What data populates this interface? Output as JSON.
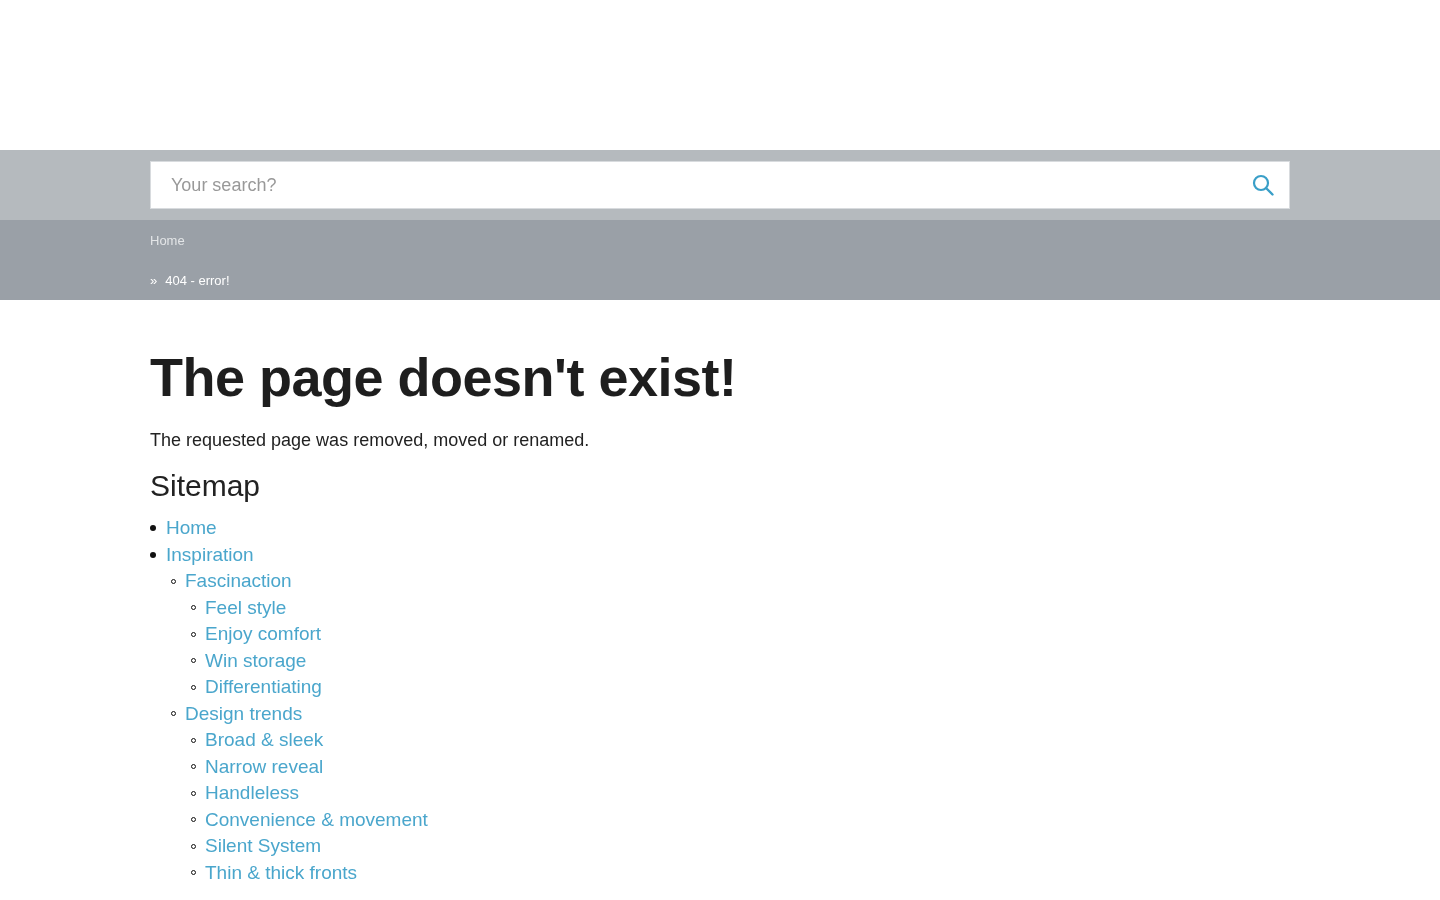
{
  "search": {
    "placeholder": "Your search?"
  },
  "breadcrumb": [
    {
      "label": "Home",
      "kind": "link"
    },
    {
      "label": "404 - error!",
      "kind": "current",
      "separator": "»"
    }
  ],
  "heading": "The page doesn't exist!",
  "message": "The requested page was removed, moved or renamed.",
  "sitemap": {
    "title": "Sitemap",
    "items": [
      {
        "label": "Home"
      },
      {
        "label": "Inspiration",
        "children": [
          {
            "label": "Fascinaction",
            "children": [
              {
                "label": "Feel style"
              },
              {
                "label": "Enjoy comfort"
              },
              {
                "label": "Win storage"
              },
              {
                "label": "Differentiating"
              }
            ]
          },
          {
            "label": "Design trends",
            "children": [
              {
                "label": "Broad & sleek"
              },
              {
                "label": "Narrow reveal"
              },
              {
                "label": "Handleless"
              },
              {
                "label": "Convenience & movement"
              },
              {
                "label": "Silent System"
              },
              {
                "label": "Thin & thick fronts"
              }
            ]
          }
        ]
      }
    ]
  }
}
